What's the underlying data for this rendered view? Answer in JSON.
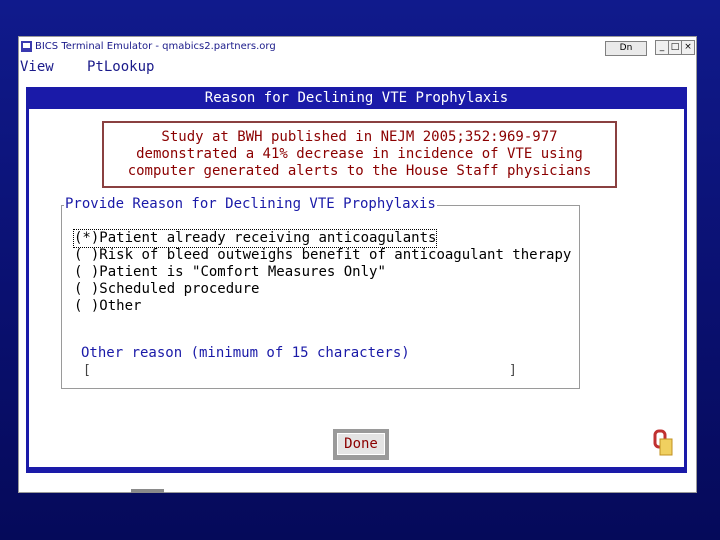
{
  "window": {
    "title": "BICS Terminal Emulator - qmabics2.partners.org",
    "dn_label": "Dn",
    "controls": {
      "minimize": "_",
      "maximize": "□",
      "close": "×"
    }
  },
  "menu": {
    "items": [
      "View",
      "PtLookup"
    ]
  },
  "dialog": {
    "header": "Reason for Declining VTE Prophylaxis",
    "notice_lines": [
      "Study at BWH published in NEJM 2005;352:969-977",
      "demonstrated a 41% decrease in incidence of VTE using",
      "computer generated alerts to the House Staff physicians"
    ],
    "group_label": "Provide Reason for Declining VTE Prophylaxis",
    "options": [
      {
        "marker": "(*)",
        "label": "Patient already receiving anticoagulants"
      },
      {
        "marker": "( )",
        "label": "Risk of bleed outweighs benefit of anticoagulant therapy"
      },
      {
        "marker": "( )",
        "label": "Patient is \"Comfort Measures Only\""
      },
      {
        "marker": "( )",
        "label": "Scheduled procedure"
      },
      {
        "marker": "( )",
        "label": "Other"
      }
    ],
    "other_reason_label": "Other reason (minimum of 15 characters)",
    "other_reason_value": "",
    "done_label": "Done"
  },
  "colors": {
    "terminal_blue": "#1a1aa8",
    "notice_red": "#8b0000",
    "background_navy": "#0a1070"
  }
}
